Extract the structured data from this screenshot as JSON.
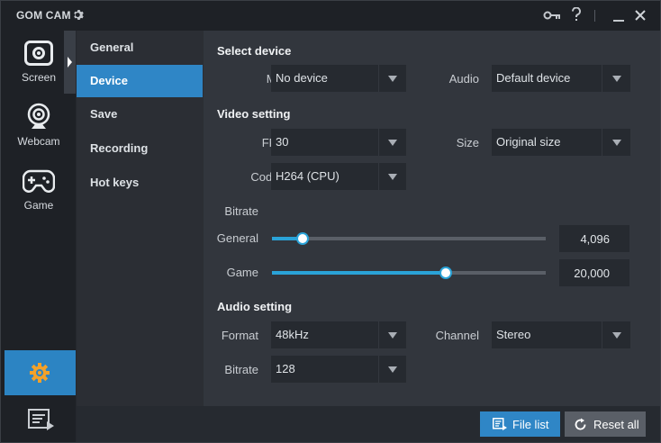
{
  "app": {
    "title": "GOM CAM"
  },
  "colors": {
    "accent": "#2f86c6",
    "slider": "#2aa3d8",
    "reset_button": "#5a5f67"
  },
  "sidebar": {
    "items": [
      {
        "label": "Screen",
        "icon": "screen-capture-icon"
      },
      {
        "label": "Webcam",
        "icon": "webcam-icon"
      },
      {
        "label": "Game",
        "icon": "gamepad-icon"
      }
    ],
    "bottom": [
      {
        "icon": "settings-gear-icon"
      },
      {
        "icon": "file-list-icon"
      }
    ]
  },
  "menu": {
    "items": [
      "General",
      "Device",
      "Save",
      "Recording",
      "Hot keys"
    ],
    "active": "Device"
  },
  "select_device": {
    "title": "Select device",
    "mic_label": "Mic",
    "mic_value": "No device",
    "audio_label": "Audio",
    "audio_value": "Default device"
  },
  "video_setting": {
    "title": "Video setting",
    "fps_label": "FPS",
    "fps_value": "30",
    "size_label": "Size",
    "size_value": "Original size",
    "codec_label": "Codec",
    "codec_value": "H264 (CPU)",
    "bitrate_label": "Bitrate",
    "general_label": "General",
    "general_value": "4,096",
    "general_level": 0.11,
    "game_label": "Game",
    "game_value": "20,000",
    "game_level": 0.63
  },
  "audio_setting": {
    "title": "Audio setting",
    "format_label": "Format",
    "format_value": "48kHz",
    "channel_label": "Channel",
    "channel_value": "Stereo",
    "bitrate_label": "Bitrate",
    "bitrate_value": "128"
  },
  "footer": {
    "file_list": "File list",
    "reset_all": "Reset all"
  }
}
